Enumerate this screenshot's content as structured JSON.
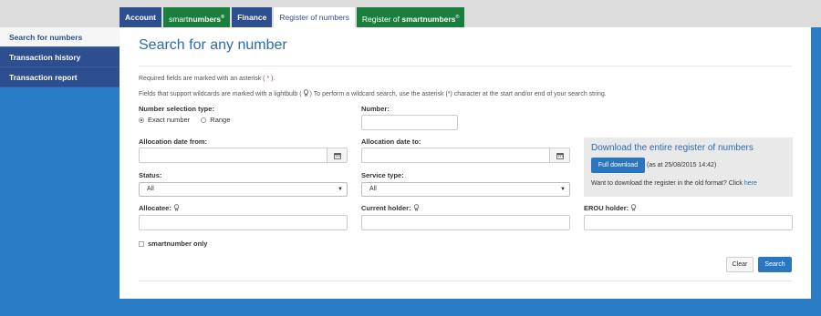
{
  "tabs": [
    {
      "label": "Account"
    },
    {
      "prefix": "smart",
      "label": "numbers",
      "sup": "®"
    },
    {
      "label": "Finance"
    },
    {
      "label": "Register of numbers"
    },
    {
      "prefix": "Register of ",
      "label": "smart",
      "rest": "numbers",
      "sup": "®"
    }
  ],
  "sidebar": {
    "items": [
      {
        "label": "Search for numbers"
      },
      {
        "label": "Transaction history"
      },
      {
        "label": "Transaction report"
      }
    ]
  },
  "main": {
    "title": "Search for any number",
    "required_note_pre": "Required fields are marked with an asterisk (",
    "required_asterisk": " * ",
    "required_note_post": ").",
    "wildcard_note": "Fields that support wildcards are marked with a lightbulb ( Ὂ1 ) To perform a wildcard search, use the asterisk (*) character at the start and/or end of your search string.",
    "wildcard_pre": "Fields that support wildcards are marked with a lightbulb (",
    "wildcard_post": ") To perform a wildcard search, use the asterisk (*) character at the start and/or end of your search string.",
    "number_selection_label": "Number selection type:",
    "radio_exact": "Exact number",
    "radio_range": "Range",
    "number_label": "Number:",
    "number_value": "",
    "alloc_from_label": "Allocation date from:",
    "alloc_to_label": "Allocation date to:",
    "status_label": "Status:",
    "status_value": "All",
    "service_label": "Service type:",
    "service_value": "All",
    "allocatee_label": "Allocatee:",
    "current_holder_label": "Current holder:",
    "erou_label": "EROU holder:",
    "smartnumber_only": "smartnumber only",
    "clear_label": "Clear",
    "search_label": "Search"
  },
  "download": {
    "title": "Download the entire register of numbers",
    "button": "Full download",
    "as_at": "(as at 25/08/2015 14:42)",
    "old_pre": "Want to download the register in the old format? Click ",
    "old_link": "here"
  },
  "icons": {
    "calendar": "calendar-icon",
    "bulb": "lightbulb-icon",
    "dropdown": "chevron-down-icon"
  },
  "colors": {
    "accent": "#2a76c0",
    "navy": "#2d4f8f",
    "green": "#1a7f3c",
    "background": "#2a7cc7"
  }
}
